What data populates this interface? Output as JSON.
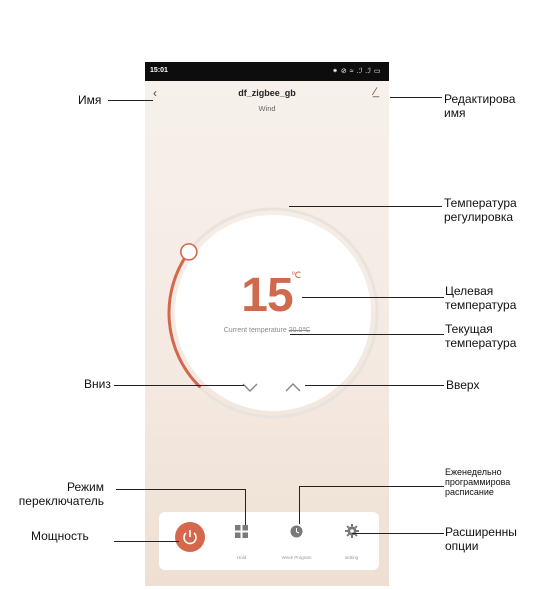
{
  "phone": {
    "status_time": "15:01",
    "status_right": "⁕ ⊘ ≈ .ℐ .ℐ ▭",
    "device_name": "df_zigbee_gb",
    "mode": "Wind",
    "target_temp": "15",
    "temp_unit": "℃",
    "current_temp_label": "Current temperature",
    "current_temp_value": "20.0℃",
    "setpoint_fraction": 0.3,
    "toolbar": {
      "hold_label": "Hold",
      "week_label": "Week Program",
      "setting_label": "setting"
    },
    "colors": {
      "accent": "#d4674c",
      "ring": "#e8e2dc",
      "bg": "#f4e9e1"
    }
  },
  "callouts": {
    "name": "Имя",
    "edit_name_1": "Редактирова",
    "edit_name_2": "имя",
    "temp_adjust_1": "Температура",
    "temp_adjust_2": "регулировка",
    "target_1": "Целевая",
    "target_2": "температура",
    "current_1": "Текущая",
    "current_2": "температура",
    "down": "Вниз",
    "up": "Вверх",
    "mode_1": "Режим",
    "mode_2": "переключатель",
    "power": "Мощность",
    "weekly_1": "Еженедельно",
    "weekly_2": "программирова",
    "weekly_3": "расписание",
    "advanced_1": "Расширенны",
    "advanced_2": "опции"
  }
}
